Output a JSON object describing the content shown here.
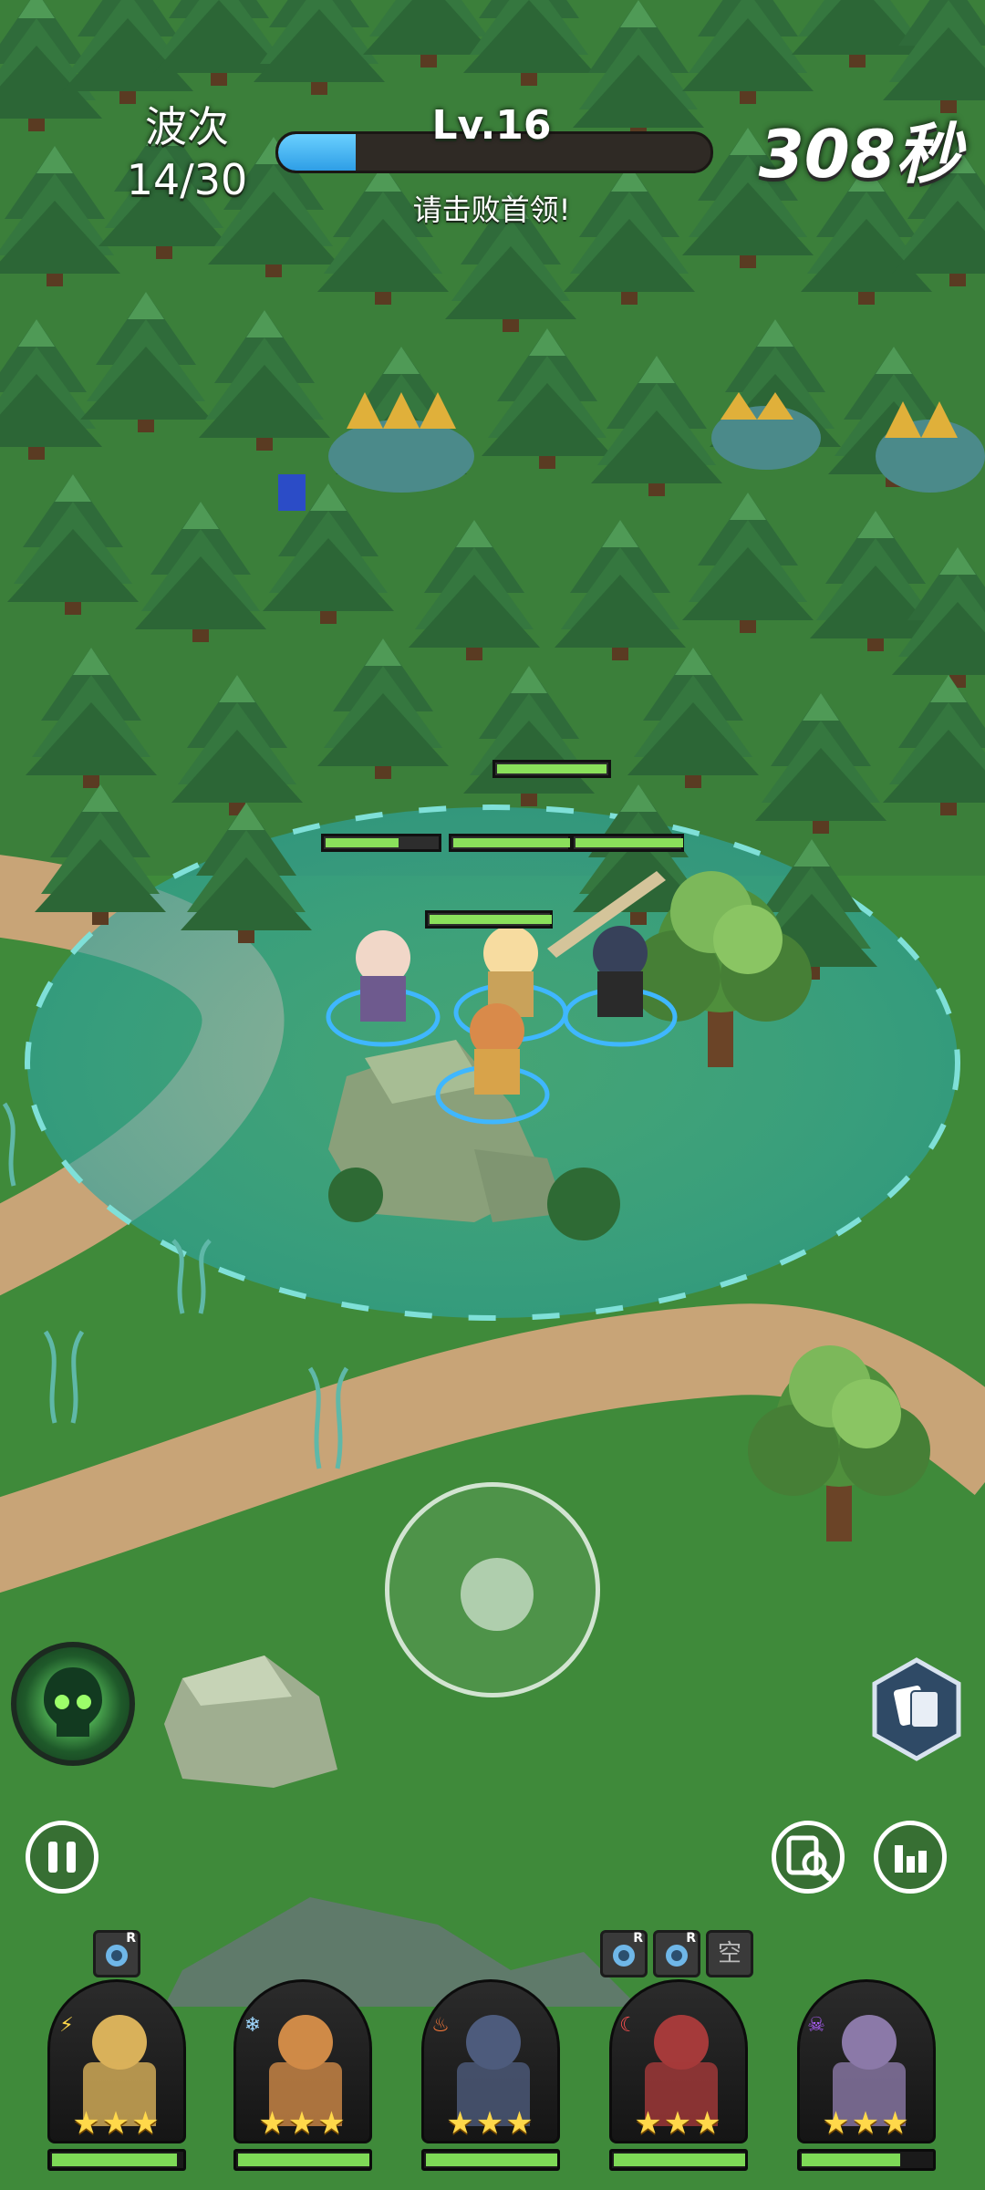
{
  "hud": {
    "wave_label": "波次",
    "wave_value": "14/30",
    "level": "Lv.16",
    "level_progress": 0.18,
    "objective": "请击败首领!",
    "timer": "308秒"
  },
  "controls": {
    "pause_icon": "pause-icon",
    "skill_icon": "dark-skull-skill-icon",
    "cards_icon": "cards-icon",
    "zoom_icon": "magnify-map-icon",
    "stats_icon": "bar-chart-icon"
  },
  "heroes": [
    {
      "element": "lightning-icon",
      "stars": "★★★",
      "hp": 0.95,
      "gear": [
        "R"
      ]
    },
    {
      "element": "frost-icon",
      "stars": "★★★",
      "hp": 1.0,
      "gear": []
    },
    {
      "element": "fire-icon",
      "stars": "★★★",
      "hp": 1.0,
      "gear": []
    },
    {
      "element": "moon-icon",
      "stars": "★★★",
      "hp": 1.0,
      "gear": [
        "R",
        "R",
        "空"
      ]
    },
    {
      "element": "poison-icon",
      "stars": "★★★",
      "hp": 0.75,
      "gear": []
    }
  ],
  "colors": {
    "grass": "#3f8a3a",
    "aura": "#3fb5b0",
    "hp_green": "#8ae05b",
    "level_blue": "#2e9ee6",
    "star_gold": "#ffd84a"
  }
}
